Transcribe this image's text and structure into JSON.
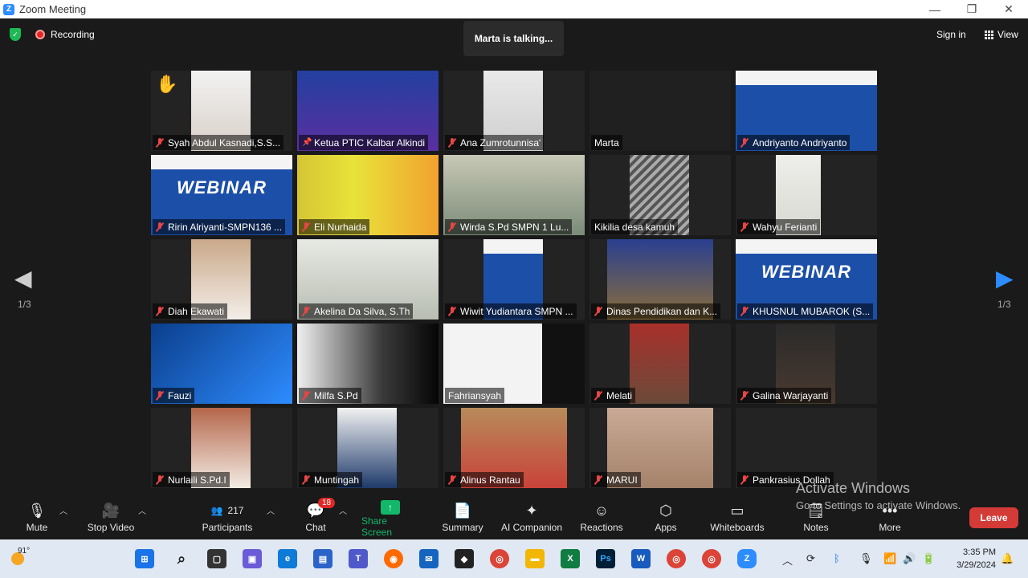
{
  "window": {
    "title": "Zoom Meeting",
    "minimize": "—",
    "maximize": "❐",
    "close": "✕"
  },
  "topbar": {
    "recording": "Recording",
    "talking": "Marta is talking...",
    "sign_in": "Sign in",
    "view": "View"
  },
  "pagination": {
    "left": "1/3",
    "right": "1/3"
  },
  "participants": [
    {
      "name": "Syah Abdul Kasnadi,S.S...",
      "muted": true,
      "hand_raised": true
    },
    {
      "name": "Ketua PTIC Kalbar Alkindi",
      "muted": false,
      "pinned": true
    },
    {
      "name": "Ana Zumrotunnisa'",
      "muted": true
    },
    {
      "name": "Marta",
      "muted": false,
      "speaking": true
    },
    {
      "name": "Andriyanto Andriyanto",
      "muted": true
    },
    {
      "name": "Ririn Alriyanti-SMPN136 ...",
      "muted": true,
      "banner": "WEBINAR"
    },
    {
      "name": "Eli Nurhaida",
      "muted": true
    },
    {
      "name": "Wirda S.Pd SMPN 1 Lu...",
      "muted": true
    },
    {
      "name": "Kikilia desa kamuh",
      "muted": false
    },
    {
      "name": "Wahyu Ferianti",
      "muted": true
    },
    {
      "name": "Diah Ekawati",
      "muted": true
    },
    {
      "name": "Akelina Da Silva, S.Th",
      "muted": true
    },
    {
      "name": "Wiwit Yudiantara SMPN ...",
      "muted": true
    },
    {
      "name": "Dinas Pendidikan dan K...",
      "muted": true
    },
    {
      "name": "KHUSNUL MUBAROK (S...",
      "muted": true,
      "banner": "WEBINAR"
    },
    {
      "name": "Fauzi",
      "muted": true
    },
    {
      "name": "Milfa S.Pd",
      "muted": true
    },
    {
      "name": "Fahriansyah",
      "muted": false
    },
    {
      "name": "Melati",
      "muted": true
    },
    {
      "name": "Galina Warjayanti",
      "muted": true
    },
    {
      "name": "Nurlaili S.Pd.I",
      "muted": true
    },
    {
      "name": "Muntingah",
      "muted": true
    },
    {
      "name": "Alinus Rantau",
      "muted": true
    },
    {
      "name": "MARUI",
      "muted": true
    },
    {
      "name": "Pankrasius Dollah",
      "muted": true
    }
  ],
  "toolbar": {
    "mute": "Mute",
    "stop_video": "Stop Video",
    "participants_count": "217",
    "participants": "Participants",
    "chat": "Chat",
    "chat_badge": "18",
    "share_screen": "Share Screen",
    "summary": "Summary",
    "ai_companion": "AI Companion",
    "reactions": "Reactions",
    "apps": "Apps",
    "whiteboards": "Whiteboards",
    "notes": "Notes",
    "more": "More",
    "leave": "Leave"
  },
  "watermark": {
    "line1": "Activate Windows",
    "line2": "Go to Settings to activate Windows."
  },
  "taskbar": {
    "weather": "91°",
    "time": "3:35 PM",
    "date": "3/29/2024"
  },
  "colors": {
    "speaking_border": "#e7eba0",
    "leave": "#d43a36",
    "share": "#12b76a",
    "muted": "#e84545"
  }
}
